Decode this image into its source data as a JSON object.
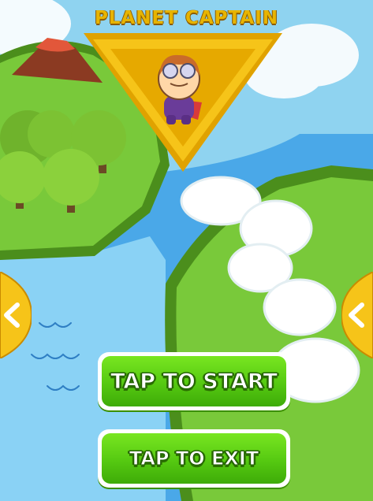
{
  "title": "PLANET CAPTAIN",
  "buttons": {
    "start_label": "TAP TO START",
    "exit_label": "TAP TO EXIT"
  },
  "icons": {
    "badge": "captain-badge-icon",
    "left_arrow": "left-arrow-icon",
    "right_arrow": "right-arrow-icon"
  },
  "colors": {
    "sky": "#8fd3f0",
    "water": "#4aa8e8",
    "land": "#6bbf2a",
    "title": "#e7b400",
    "button_green": "#55c911"
  }
}
